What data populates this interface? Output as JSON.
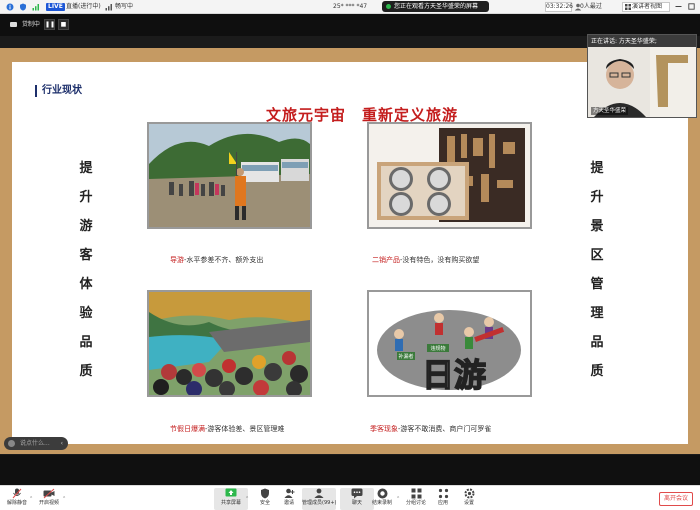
{
  "topbar": {
    "live_label": "LIVE",
    "live_status": "直播(进行中)",
    "signal_label": "畅写中",
    "phone": "25* *** *47",
    "viewing_text": "您正在观看方天圣华盛荣的屏幕",
    "timer": "03:32:26",
    "viewers": "0人最过",
    "speaker_view": "演讲者视图"
  },
  "secondbar": {
    "share_label": "贷制中"
  },
  "slide": {
    "section_title": "行业现状",
    "main_title": "文旅元宇宙　重新定义旅游",
    "left_side": "提升游客体验品质",
    "right_side": "提升景区管理品质",
    "captions": [
      {
        "red": "导游",
        "text": "-水平参差不齐、额外支出"
      },
      {
        "red": "二销产品",
        "text": "-没有特色，没有购买欲望"
      },
      {
        "red": "节假日爆满",
        "text": "-游客体验差、景区管理难"
      },
      {
        "red": "季客现象",
        "text": "-游客不敢消费、商户门可罗雀"
      }
    ],
    "cartoon": {
      "big_text": "日游",
      "sign1": "补漏者",
      "sign2": "违规物"
    }
  },
  "speaker": {
    "label": "正在讲话: 方天圣华盛荣;",
    "name": "方天圣华盛荣"
  },
  "chat": {
    "placeholder": "说点什么..."
  },
  "toolbar": {
    "mute": "解除静音",
    "video": "开启视频",
    "share": "共享屏幕",
    "security": "安全",
    "invite": "邀请",
    "members": "管理成员(99+)",
    "chat": "聊天",
    "record": "结束录制",
    "breakout": "分组讨论",
    "apps": "应用",
    "settings": "设置",
    "leave": "离开会议"
  },
  "colors": {
    "accent": "#c41d1d",
    "navy": "#1d2f6b",
    "frame": "#c59a63"
  }
}
